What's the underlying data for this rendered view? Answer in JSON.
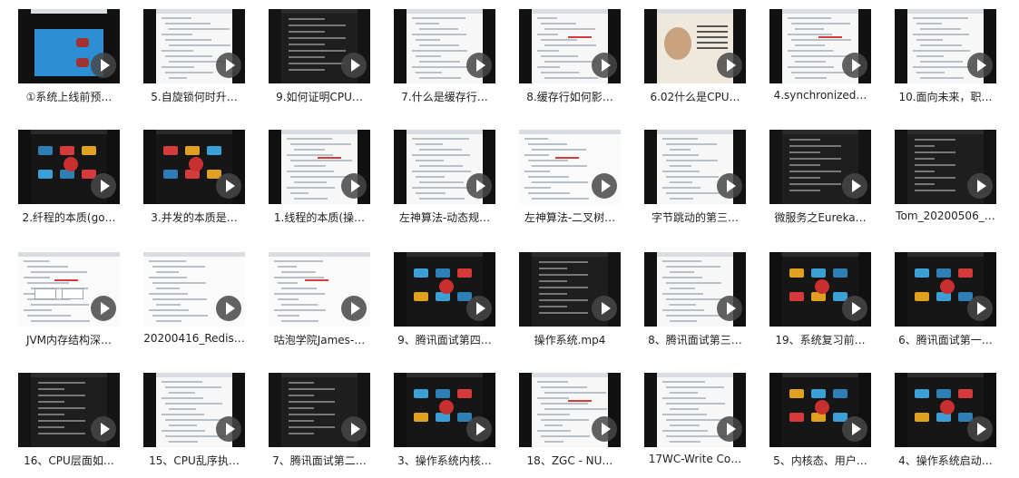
{
  "videos": [
    {
      "label": "①系统上线前预…",
      "thumb": "blue"
    },
    {
      "label": "5.自旋锁何时升…",
      "thumb": "light"
    },
    {
      "label": "9.如何证明CPU…",
      "thumb": "dark"
    },
    {
      "label": "7.什么是缓存行…",
      "thumb": "light"
    },
    {
      "label": "8.缓存行如何影…",
      "thumb": "light"
    },
    {
      "label": "6.02什么是CPU…",
      "thumb": "person"
    },
    {
      "label": "4.synchronized…",
      "thumb": "light"
    },
    {
      "label": "10.面向未来，职…",
      "thumb": "light"
    },
    {
      "label": "2.纤程的本质(go…",
      "thumb": "darkmap"
    },
    {
      "label": "3.并发的本质是…",
      "thumb": "darkmap"
    },
    {
      "label": "1.线程的本质(操…",
      "thumb": "light"
    },
    {
      "label": "左神算法-动态规…",
      "thumb": "light"
    },
    {
      "label": "左神算法-二叉树…",
      "thumb": "white"
    },
    {
      "label": "字节跳动的第三…",
      "thumb": "light"
    },
    {
      "label": "微服务之Eureka…",
      "thumb": "dark"
    },
    {
      "label": "Tom_20200506_…",
      "thumb": "dark"
    },
    {
      "label": "JVM内存结构深…",
      "thumb": "white"
    },
    {
      "label": "20200416_Redis…",
      "thumb": "white"
    },
    {
      "label": "咕泡学院James-…",
      "thumb": "white"
    },
    {
      "label": "9、腾讯面试第四…",
      "thumb": "darkmap"
    },
    {
      "label": "操作系统.mp4",
      "thumb": "dark"
    },
    {
      "label": "8、腾讯面试第三…",
      "thumb": "light"
    },
    {
      "label": "19、系统复习前…",
      "thumb": "darkmap"
    },
    {
      "label": "6、腾讯面试第一…",
      "thumb": "darkmap"
    },
    {
      "label": "16、CPU层面如…",
      "thumb": "dark"
    },
    {
      "label": "15、CPU乱序执…",
      "thumb": "light"
    },
    {
      "label": "7、腾讯面试第二…",
      "thumb": "dark"
    },
    {
      "label": "3、操作系统内核…",
      "thumb": "darkmap"
    },
    {
      "label": "18、ZGC - NU…",
      "thumb": "light"
    },
    {
      "label": "17WC-Write Co…",
      "thumb": "light"
    },
    {
      "label": "5、内核态、用户…",
      "thumb": "darkmap"
    },
    {
      "label": "4、操作系统启动…",
      "thumb": "darkmap"
    }
  ]
}
